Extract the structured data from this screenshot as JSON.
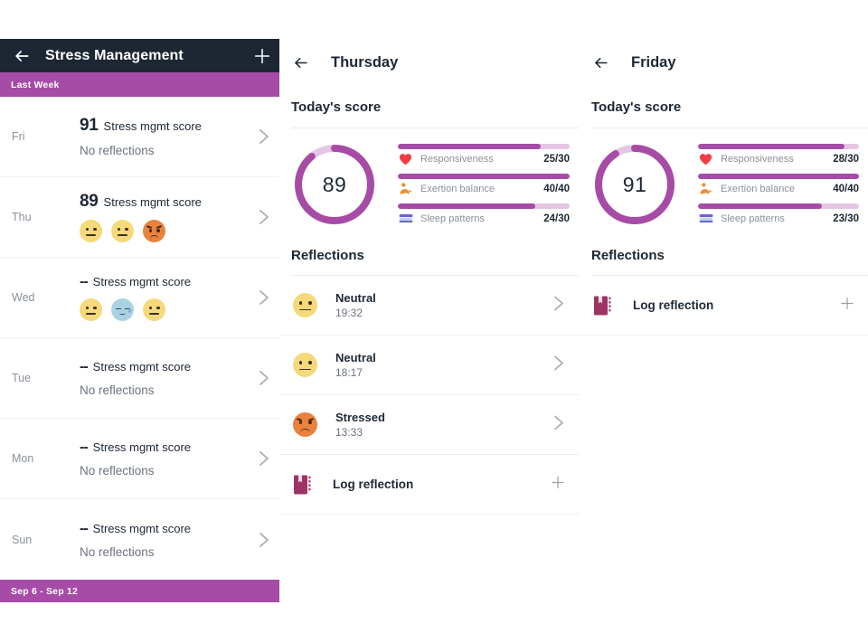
{
  "theme": {
    "appbar_bg": "#1d2733",
    "accent": "#a64ba6",
    "accent_light": "#e4c6e4",
    "text": "#1d2733",
    "muted": "#8a9099"
  },
  "left_panel": {
    "appbar": {
      "back_icon": "arrow-left-icon",
      "title": "Stress Management",
      "add_icon": "plus-icon"
    },
    "week_band_top": "Last Week",
    "week_band_bottom": "Sep 6 - Sep 12",
    "score_label": "Stress mgmt score",
    "no_reflections_label": "No reflections",
    "days": [
      {
        "day": "Fri",
        "score": "91",
        "has_score": true,
        "reflections": []
      },
      {
        "day": "Thu",
        "score": "89",
        "has_score": true,
        "reflections": [
          "neutral",
          "neutral",
          "stressed"
        ]
      },
      {
        "day": "Wed",
        "score": "--",
        "has_score": false,
        "reflections": [
          "neutral",
          "relieved",
          "neutral"
        ]
      },
      {
        "day": "Tue",
        "score": "--",
        "has_score": false,
        "reflections": []
      },
      {
        "day": "Mon",
        "score": "--",
        "has_score": false,
        "reflections": []
      },
      {
        "day": "Sun",
        "score": "--",
        "has_score": false,
        "reflections": []
      }
    ]
  },
  "mid_panel": {
    "back_icon": "arrow-left-icon",
    "title": "Thursday",
    "today_score_label": "Today's score",
    "score": "89",
    "score_ring_percent": 89,
    "stats": [
      {
        "icon": "heart-icon",
        "name": "Responsiveness",
        "value": "25/30",
        "percent": 83
      },
      {
        "icon": "flex-arm-icon",
        "name": "Exertion balance",
        "value": "40/40",
        "percent": 100
      },
      {
        "icon": "bed-icon",
        "name": "Sleep patterns",
        "value": "24/30",
        "percent": 80
      }
    ],
    "reflections_label": "Reflections",
    "reflections": [
      {
        "mood": "Neutral",
        "time": "19:32",
        "face": "neutral"
      },
      {
        "mood": "Neutral",
        "time": "18:17",
        "face": "neutral"
      },
      {
        "mood": "Stressed",
        "time": "13:33",
        "face": "stressed"
      }
    ],
    "log_reflection_label": "Log reflection",
    "log_icon": "book-icon",
    "log_add_icon": "plus-icon"
  },
  "right_panel": {
    "back_icon": "arrow-left-icon",
    "title": "Friday",
    "today_score_label": "Today's score",
    "score": "91",
    "score_ring_percent": 91,
    "stats": [
      {
        "icon": "heart-icon",
        "name": "Responsiveness",
        "value": "28/30",
        "percent": 91
      },
      {
        "icon": "flex-arm-icon",
        "name": "Exertion balance",
        "value": "40/40",
        "percent": 100
      },
      {
        "icon": "bed-icon",
        "name": "Sleep patterns",
        "value": "23/30",
        "percent": 77
      }
    ],
    "reflections_label": "Reflections",
    "reflections": [],
    "log_reflection_label": "Log reflection",
    "log_icon": "book-icon",
    "log_add_icon": "plus-icon"
  }
}
